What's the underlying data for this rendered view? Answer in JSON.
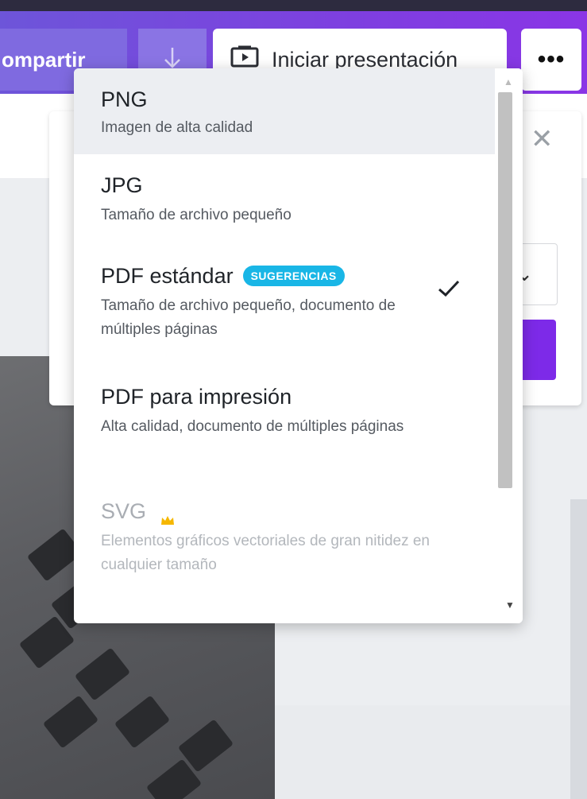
{
  "toolbar": {
    "share_label": "ompartir",
    "download_icon": "download-arrow-icon",
    "present_label": "Iniciar presentación",
    "present_icon": "presentation-icon",
    "more_label": "•••"
  },
  "dropdown": {
    "options": [
      {
        "title": "PNG",
        "desc": "Imagen de alta calidad",
        "highlighted": true,
        "selected": false,
        "disabled": false
      },
      {
        "title": "JPG",
        "desc": "Tamaño de archivo pequeño",
        "highlighted": false,
        "selected": false,
        "disabled": false
      },
      {
        "title": "PDF estándar",
        "badge": "SUGERENCIAS",
        "desc": "Tamaño de archivo pequeño, documento de múltiples páginas",
        "highlighted": false,
        "selected": true,
        "disabled": false
      },
      {
        "title": "PDF para impresión",
        "desc": "Alta calidad, documento de múltiples páginas",
        "highlighted": false,
        "selected": false,
        "disabled": false
      },
      {
        "title": "SVG",
        "desc": "Elementos gráficos vectoriales de gran nitidez en cualquier tamaño",
        "highlighted": false,
        "selected": false,
        "disabled": true,
        "premium_icon": "crown-icon"
      }
    ]
  },
  "colors": {
    "accent": "#7d2ae8",
    "badge": "#19b6e6",
    "crown": "#f5b700"
  }
}
